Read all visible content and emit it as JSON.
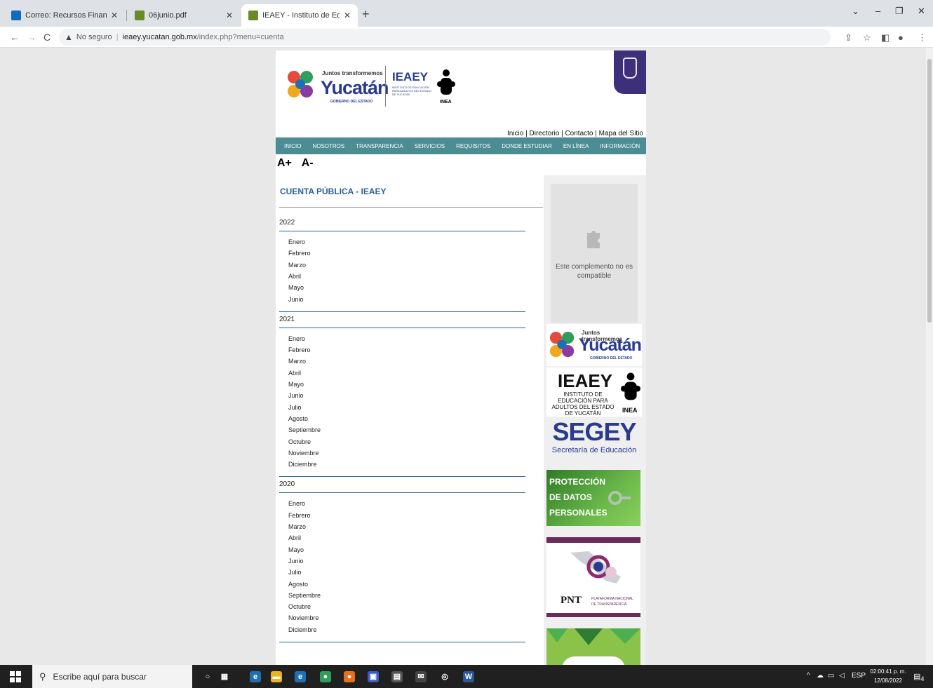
{
  "browser": {
    "tabs": [
      {
        "label": "Correo: Recursos Financieros Yuc",
        "close": "✕"
      },
      {
        "label": "06junio.pdf",
        "close": "✕"
      },
      {
        "label": "IEAEY - Instituto de Educación pa",
        "close": "✕"
      }
    ],
    "new_tab": "+",
    "window_controls": [
      "⌄",
      "–",
      "❐",
      "✕"
    ],
    "nav": {
      "back": "←",
      "forward": "→",
      "reload": "C"
    },
    "security_label": "No seguro",
    "url_host": "ieaey.yucatan.gob.mx",
    "url_path": "/index.php?menu=cuenta"
  },
  "site": {
    "logo": {
      "tagline": "Juntos transformemos",
      "name": "Yucatán",
      "gobierno": "GOBIERNO DEL ESTADO"
    },
    "ieaey": {
      "name": "IEAEY",
      "subtitle": "INSTITUTO DE EDUCACIÓN PARA ADULTOS DEL ESTADO DE YUCATÁN",
      "inea": "INEA"
    },
    "top_links": "Inicio | Directorio | Contacto | Mapa del Sitio",
    "menu": [
      "INICIO",
      "NOSOTROS",
      "TRANSPARENCIA",
      "SERVICIOS",
      "REQUISITOS",
      "DONDE ESTUDIAR",
      "EN LÍNEA",
      "INFORMACIÓN"
    ],
    "font_up": "A+",
    "font_down": "A-",
    "page_title": "CUENTA PÚBLICA - IEAEY",
    "years": [
      {
        "year": "2022",
        "months": [
          "Enero",
          "Febrero",
          "Marzo",
          "Abril",
          "Mayo",
          "Junio"
        ]
      },
      {
        "year": "2021",
        "months": [
          "Enero",
          "Febrero",
          "Marzo",
          "Abril",
          "Mayo",
          "Junio",
          "Julio",
          "Agosto",
          "Septiembre",
          "Octubre",
          "Noviembre",
          "Diciembre"
        ]
      },
      {
        "year": "2020",
        "months": [
          "Enero",
          "Febrero",
          "Marzo",
          "Abril",
          "Mayo",
          "Junio",
          "Julio",
          "Agosto",
          "Septiembre",
          "Octubre",
          "Noviembre",
          "Diciembre"
        ]
      }
    ],
    "sidebar": {
      "plugin_msg": "Este complemento no es compatible",
      "yuc_tagline": "Juntos transformemos",
      "yuc_name": "Yucatán",
      "yuc_gob": "GOBIERNO DEL ESTADO",
      "ieaey_name": "IEAEY",
      "ieaey_sub": "INSTITUTO DE EDUCACIÓN PARA ADULTOS DEL ESTADO DE YUCATÁN",
      "inea": "INEA",
      "segey": "SEGEY",
      "segey_sub": "Secretaría de Educación",
      "datos_1": "PROTECCIÓN",
      "datos_2": "DE DATOS",
      "datos_3": "PERSONALES",
      "pnt": "PNT",
      "pnt_sub_1": "PLATAFORMA NACIONAL",
      "pnt_sub_2": "DE TRANSPARENCIA"
    }
  },
  "taskbar": {
    "search_placeholder": "Escribe aquí para buscar",
    "lang": "ESP",
    "time": "02:00:41 p. m.",
    "date": "12/08/2022",
    "notif_count": "4"
  },
  "colors": {
    "menu": "#4c8d94",
    "title": "#2a5f9e",
    "brand": "#2a3b8f"
  }
}
